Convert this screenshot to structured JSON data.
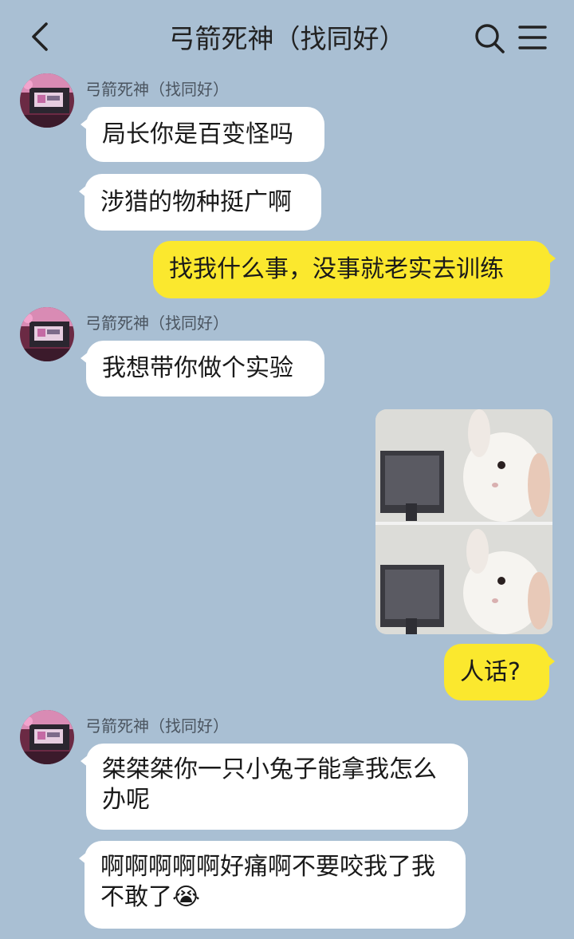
{
  "header": {
    "title": "弓箭死神（找同好）",
    "back_icon": "chevron-left-icon",
    "search_icon": "search-icon",
    "menu_icon": "hamburger-menu-icon"
  },
  "messages": [
    {
      "sender": "弓箭死神（找同好）",
      "text": "局长你是百变怪吗"
    },
    {
      "text": "涉猎的物种挺广啊"
    },
    {
      "text": "找我什么事，没事就老实去训练"
    },
    {
      "sender": "弓箭死神（找同好）",
      "text": "我想带你做个实验"
    },
    {
      "image": "rabbit-and-monitor-meme"
    },
    {
      "text": "人话?"
    },
    {
      "sender": "弓箭死神（找同好）",
      "text": "桀桀桀你一只小兔子能拿我怎么办呢"
    },
    {
      "text": "啊啊啊啊啊好痛啊不要咬我了我不敢了😭"
    }
  ],
  "colors": {
    "background": "#a9bfd3",
    "incoming_bubble": "#ffffff",
    "outgoing_bubble": "#fbe82e"
  }
}
